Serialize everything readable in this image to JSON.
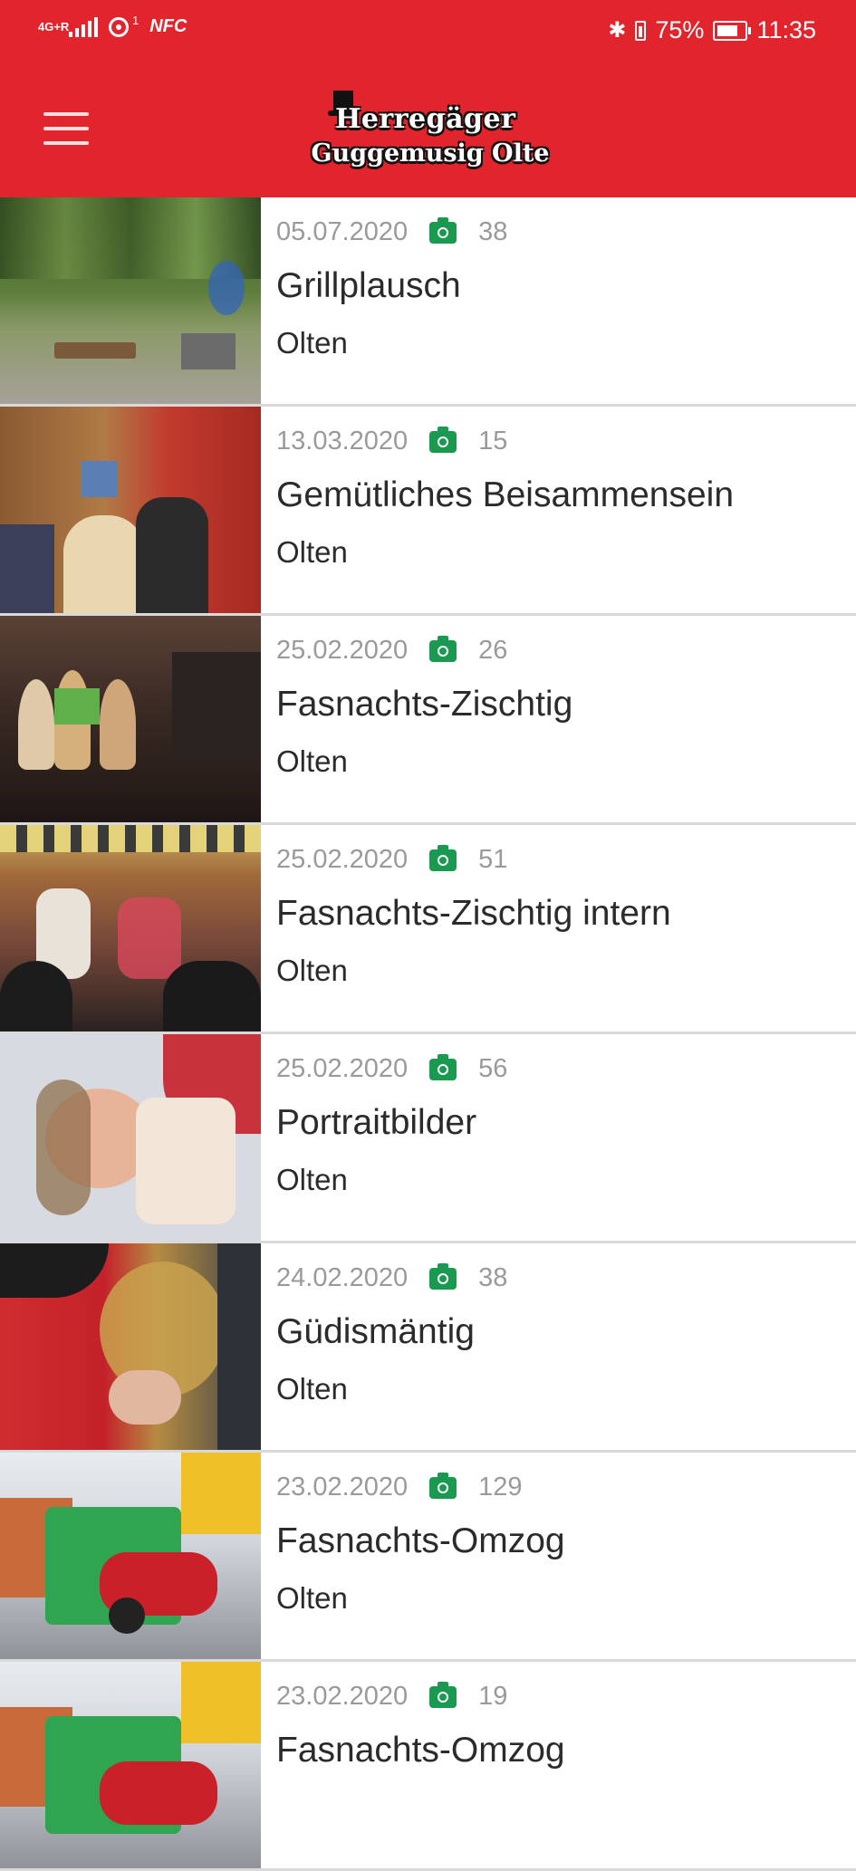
{
  "status_bar": {
    "network": "4G+R",
    "signal_sup": "1",
    "nfc": "NFC",
    "battery": "75%",
    "time": "11:35"
  },
  "header": {
    "logo_line1": "Herregäger",
    "logo_line2": "Guggemusig Olte",
    "brand_color": "#e2242c",
    "menu_icon": "hamburger-menu-icon"
  },
  "albums": [
    {
      "date": "05.07.2020",
      "count": "38",
      "title": "Grillplausch",
      "place": "Olten"
    },
    {
      "date": "13.03.2020",
      "count": "15",
      "title": "Gemütliches Beisammensein",
      "place": "Olten"
    },
    {
      "date": "25.02.2020",
      "count": "26",
      "title": "Fasnachts-Zischtig",
      "place": "Olten"
    },
    {
      "date": "25.02.2020",
      "count": "51",
      "title": "Fasnachts-Zischtig intern",
      "place": "Olten"
    },
    {
      "date": "25.02.2020",
      "count": "56",
      "title": "Portraitbilder",
      "place": "Olten"
    },
    {
      "date": "24.02.2020",
      "count": "38",
      "title": "Güdismäntig",
      "place": "Olten"
    },
    {
      "date": "23.02.2020",
      "count": "129",
      "title": "Fasnachts-Omzog",
      "place": "Olten"
    },
    {
      "date": "23.02.2020",
      "count": "19",
      "title": "Fasnachts-Omzog",
      "place": ""
    }
  ],
  "photo_count_icon": "camera-icon",
  "photo_count_icon_color": "#1a9a50"
}
